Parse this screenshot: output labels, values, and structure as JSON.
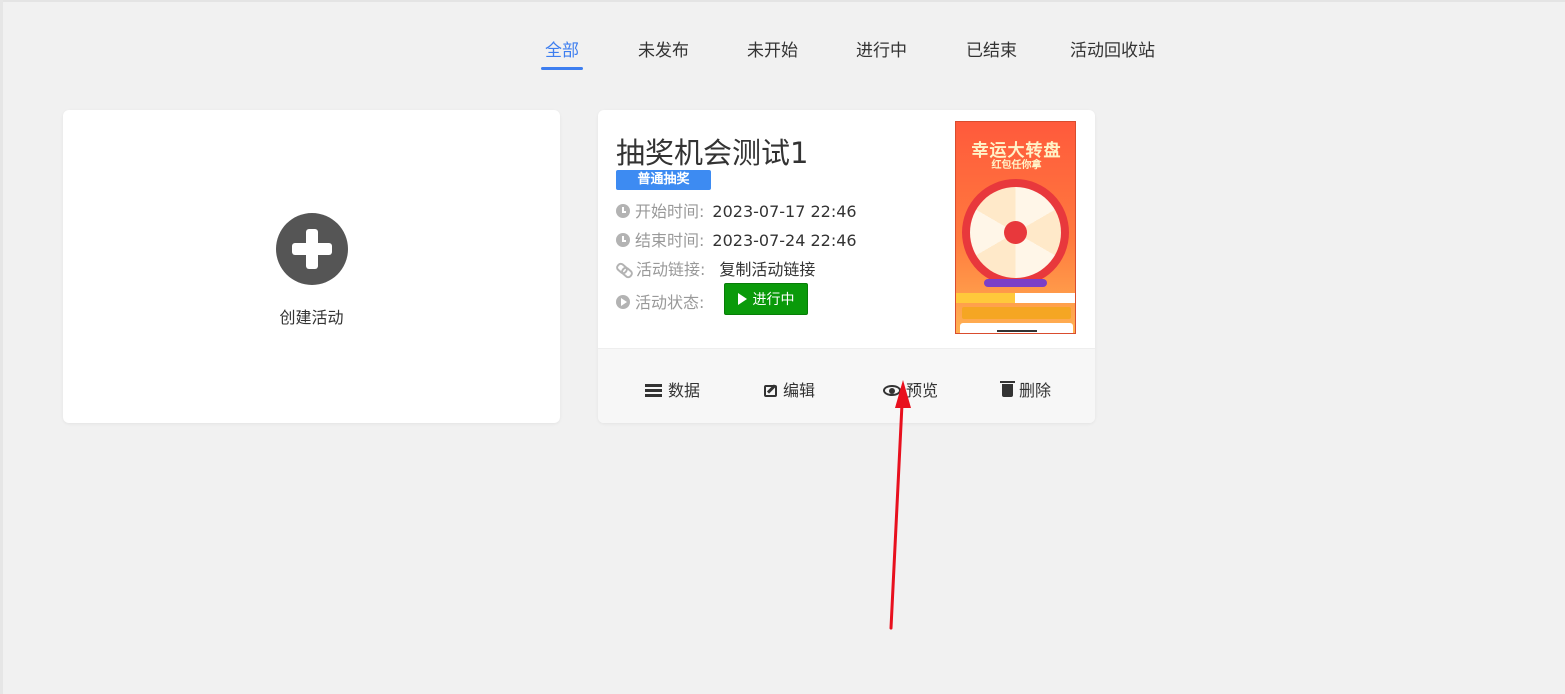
{
  "tabs": [
    {
      "label": "全部",
      "active": true
    },
    {
      "label": "未发布"
    },
    {
      "label": "未开始"
    },
    {
      "label": "进行中"
    },
    {
      "label": "已结束"
    },
    {
      "label": "活动回收站"
    }
  ],
  "create_card": {
    "label": "创建活动",
    "icon": "plus-circle-icon"
  },
  "activity": {
    "title": "抽奖机会测试1",
    "badge": "普通抽奖",
    "start_label": "开始时间:",
    "start_value": "2023-07-17 22:46",
    "end_label": "结束时间:",
    "end_value": "2023-07-24 22:46",
    "link_label": "活动链接:",
    "link_action": "复制活动链接",
    "status_label": "活动状态:",
    "status_value": "进行中",
    "status_color": "#0a9a0a",
    "poster": {
      "title": "幸运大转盘",
      "subtitle": "红包任你拿"
    },
    "actions": {
      "data": "数据",
      "edit": "编辑",
      "preview": "预览",
      "delete": "删除"
    }
  },
  "colors": {
    "accent": "#3d7ef0",
    "badge": "#3d8bf2",
    "annotation_arrow": "#e8101e"
  }
}
